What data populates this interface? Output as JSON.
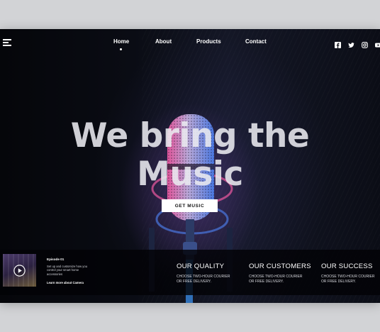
{
  "nav": {
    "items": [
      {
        "label": "Home",
        "active": true
      },
      {
        "label": "About",
        "active": false
      },
      {
        "label": "Products",
        "active": false
      },
      {
        "label": "Contact",
        "active": false
      }
    ],
    "social": [
      "facebook-icon",
      "twitter-icon",
      "instagram-icon",
      "youtube-icon"
    ]
  },
  "hero": {
    "title_line1": "We bring the",
    "title_line2": "Music",
    "cta_label": "GET MUSIC"
  },
  "episode": {
    "title": "Episode 01",
    "description": "Set up and customize how you control your smart home accessories",
    "link": "Learn more about Camera"
  },
  "stats": [
    {
      "title": "OUR QUALITY",
      "text_line1": "CHOOSE TWO-HOUR COURIER",
      "text_line2": "OR FREE DELIVERY."
    },
    {
      "title": "OUR CUSTOMERS",
      "text_line1": "CHOOSE TWO-HOUR COURIER",
      "text_line2": "OR FREE DELIVERY."
    },
    {
      "title": "OUR SUCCESS",
      "text_line1": "CHOOSE TWO-HOUR COURIER",
      "text_line2": "OR FREE DELIVERY."
    }
  ],
  "colors": {
    "accent_pink": "#e0559b",
    "accent_blue": "#4a78e0",
    "background": "#0a0c14"
  }
}
